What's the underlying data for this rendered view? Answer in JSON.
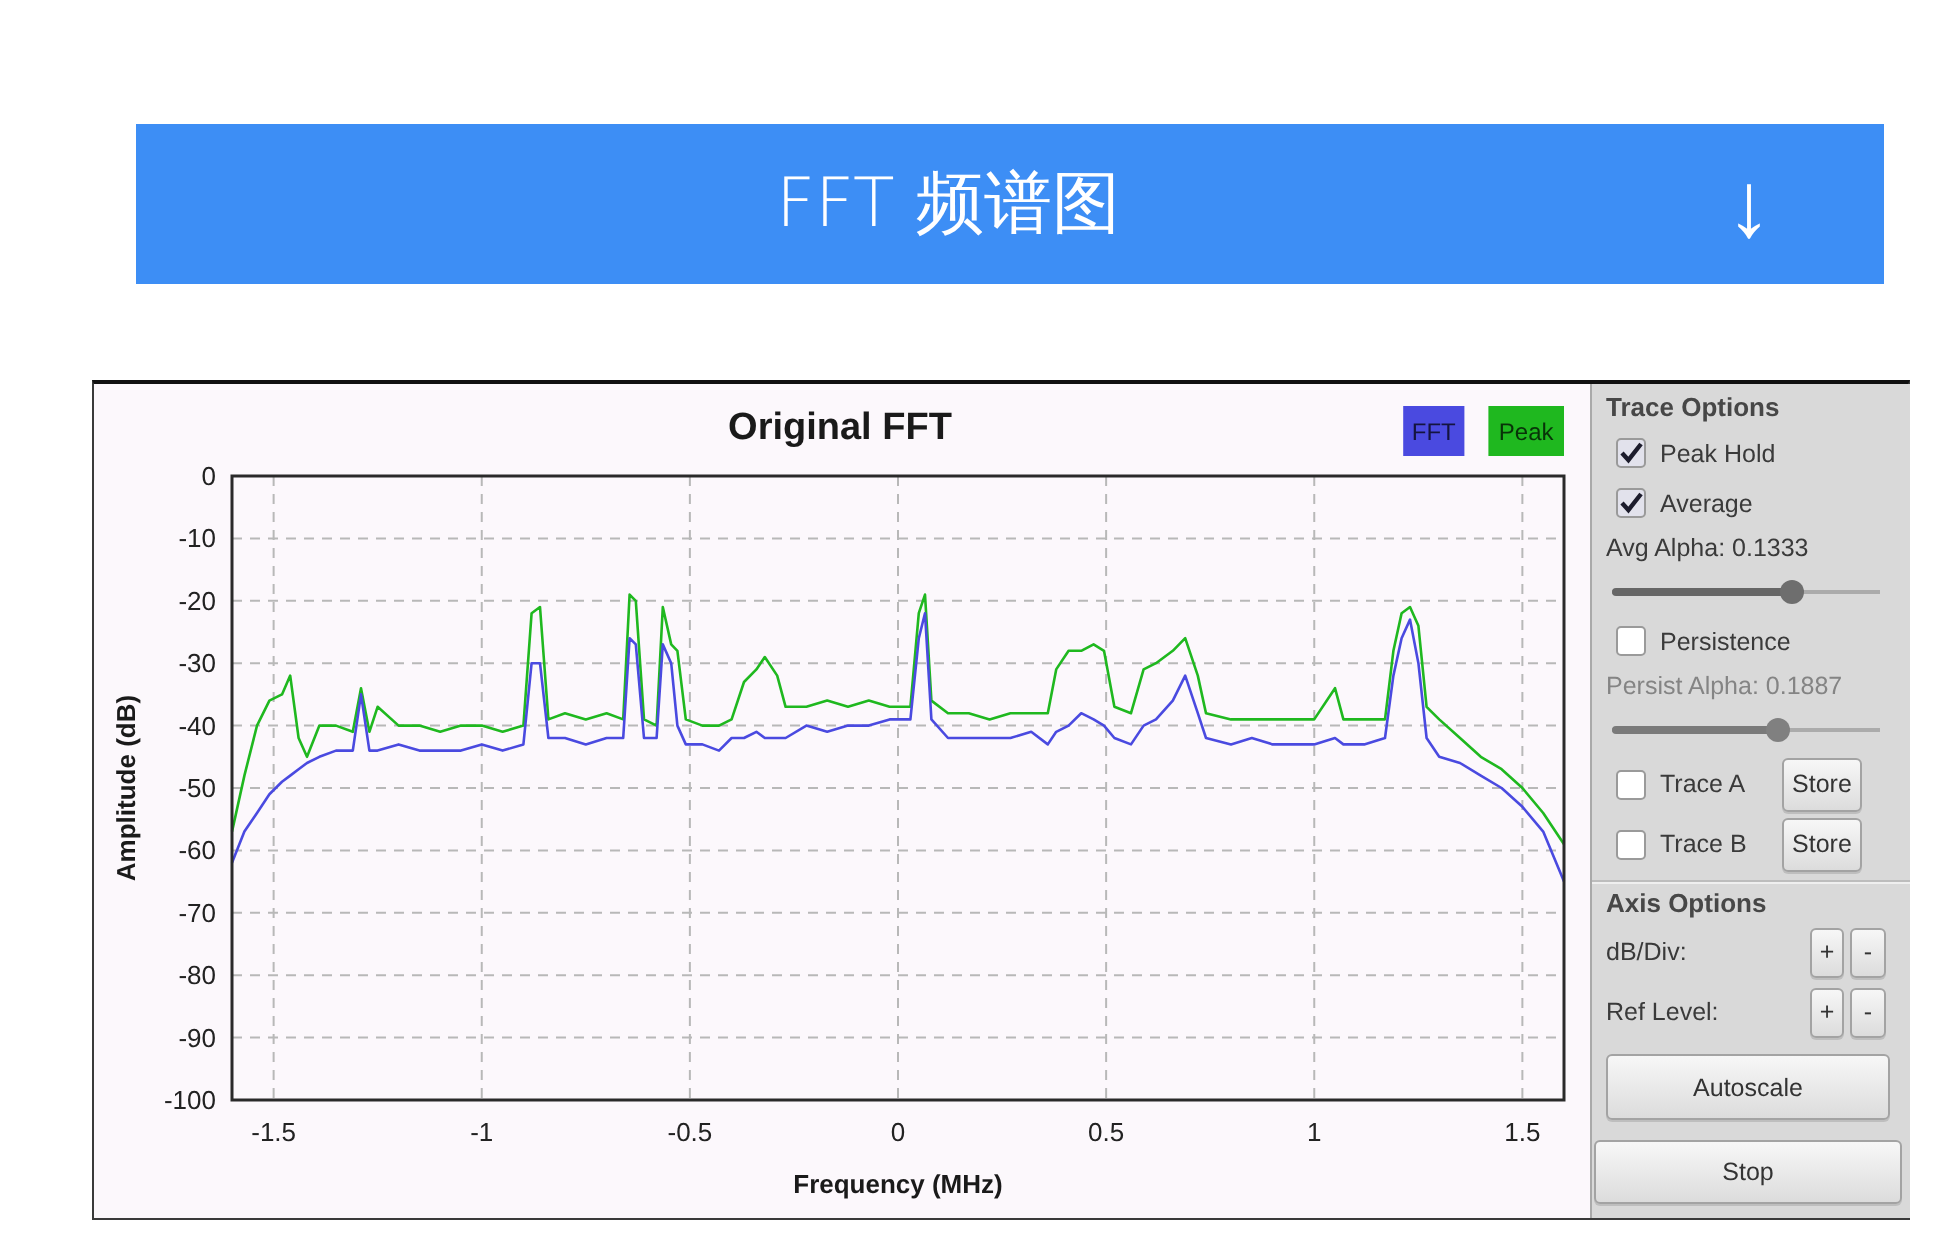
{
  "banner": {
    "title": "FFT 频谱图",
    "arrow": "↓"
  },
  "chart": {
    "chart_data": {
      "type": "line",
      "title": "Original FFT",
      "xlabel": "Frequency (MHz)",
      "ylabel": "Amplitude (dB)",
      "x": [
        -1.6,
        -1.57,
        -1.54,
        -1.51,
        -1.48,
        -1.46,
        -1.44,
        -1.42,
        -1.39,
        -1.35,
        -1.31,
        -1.29,
        -1.27,
        -1.25,
        -1.2,
        -1.15,
        -1.1,
        -1.05,
        -1,
        -0.95,
        -0.9,
        -0.88,
        -0.86,
        -0.84,
        -0.8,
        -0.75,
        -0.7,
        -0.66,
        -0.645,
        -0.63,
        -0.61,
        -0.58,
        -0.565,
        -0.545,
        -0.53,
        -0.51,
        -0.47,
        -0.43,
        -0.4,
        -0.37,
        -0.34,
        -0.32,
        -0.29,
        -0.27,
        -0.22,
        -0.17,
        -0.12,
        -0.07,
        -0.02,
        0.03,
        0.05,
        0.065,
        0.08,
        0.12,
        0.17,
        0.22,
        0.27,
        0.32,
        0.36,
        0.38,
        0.41,
        0.44,
        0.47,
        0.495,
        0.52,
        0.56,
        0.59,
        0.62,
        0.66,
        0.69,
        0.72,
        0.74,
        0.8,
        0.85,
        0.9,
        0.95,
        1,
        1.05,
        1.07,
        1.12,
        1.17,
        1.19,
        1.21,
        1.23,
        1.25,
        1.27,
        1.3,
        1.35,
        1.4,
        1.45,
        1.5,
        1.55,
        1.6
      ],
      "series": [
        {
          "name": "FFT",
          "color": "#4a4ae0",
          "values": [
            -62,
            -57,
            -54,
            -51,
            -49,
            -48,
            -47,
            -46,
            -45,
            -44,
            -44,
            -35,
            -44,
            -44,
            -43,
            -44,
            -44,
            -44,
            -43,
            -44,
            -43,
            -30,
            -30,
            -42,
            -42,
            -43,
            -42,
            -42,
            -26,
            -27,
            -42,
            -42,
            -27,
            -30,
            -40,
            -43,
            -43,
            -44,
            -42,
            -42,
            -41,
            -42,
            -42,
            -42,
            -40,
            -41,
            -40,
            -40,
            -39,
            -39,
            -26,
            -22,
            -39,
            -42,
            -42,
            -42,
            -42,
            -41,
            -43,
            -41,
            -40,
            -38,
            -39,
            -40,
            -42,
            -43,
            -40,
            -39,
            -36,
            -32,
            -38,
            -42,
            -43,
            -42,
            -43,
            -43,
            -43,
            -42,
            -43,
            -43,
            -42,
            -32,
            -26,
            -23,
            -30,
            -42,
            -45,
            -46,
            -48,
            -50,
            -53,
            -57,
            -65
          ]
        },
        {
          "name": "Peak",
          "color": "#1fb81f",
          "values": [
            -57,
            -48,
            -40,
            -36,
            -35,
            -32,
            -42,
            -45,
            -40,
            -40,
            -41,
            -34,
            -41,
            -37,
            -40,
            -40,
            -41,
            -40,
            -40,
            -41,
            -40,
            -22,
            -21,
            -39,
            -38,
            -39,
            -38,
            -39,
            -19,
            -20,
            -39,
            -40,
            -21,
            -27,
            -28,
            -39,
            -40,
            -40,
            -39,
            -33,
            -31,
            -29,
            -32,
            -37,
            -37,
            -36,
            -37,
            -36,
            -37,
            -37,
            -22,
            -19,
            -36,
            -38,
            -38,
            -39,
            -38,
            -38,
            -38,
            -31,
            -28,
            -28,
            -27,
            -28,
            -37,
            -38,
            -31,
            -30,
            -28,
            -26,
            -32,
            -38,
            -39,
            -39,
            -39,
            -39,
            -39,
            -34,
            -39,
            -39,
            -39,
            -28,
            -22,
            -21,
            -24,
            -37,
            -39,
            -42,
            -45,
            -47,
            -50,
            -54,
            -59
          ]
        }
      ],
      "xlim": [
        -1.6,
        1.6
      ],
      "ylim": [
        -100,
        0
      ],
      "xticks": [
        -1.5,
        -1,
        -0.5,
        0,
        0.5,
        1,
        1.5
      ],
      "yticks": [
        0,
        -10,
        -20,
        -30,
        -40,
        -50,
        -60,
        -70,
        -80,
        -90,
        -100
      ],
      "grid": true
    }
  },
  "trace_options": {
    "title": "Trace Options",
    "controls": [
      {
        "kind": "checkbox",
        "label": "Peak Hold",
        "checked": true
      },
      {
        "kind": "checkbox",
        "label": "Average",
        "checked": true
      },
      {
        "kind": "slider",
        "label": "Avg Alpha: 0.1333",
        "level": 0.69,
        "disabled": false
      },
      {
        "kind": "checkbox",
        "label": "Persistence",
        "checked": false
      },
      {
        "kind": "slider",
        "label": "Persist Alpha: 0.1887",
        "level": 0.63,
        "disabled": true
      },
      {
        "kind": "trace",
        "label": "Trace A",
        "checked": false,
        "button": "Store"
      },
      {
        "kind": "trace",
        "label": "Trace B",
        "checked": false,
        "button": "Store"
      }
    ]
  },
  "axis_options": {
    "title": "Axis Options",
    "rows": [
      {
        "label": "dB/Div:",
        "buttons": [
          "+",
          "-"
        ]
      },
      {
        "label": "Ref Level:",
        "buttons": [
          "+",
          "-"
        ]
      }
    ],
    "autoscale": "Autoscale"
  },
  "stop_button": "Stop"
}
